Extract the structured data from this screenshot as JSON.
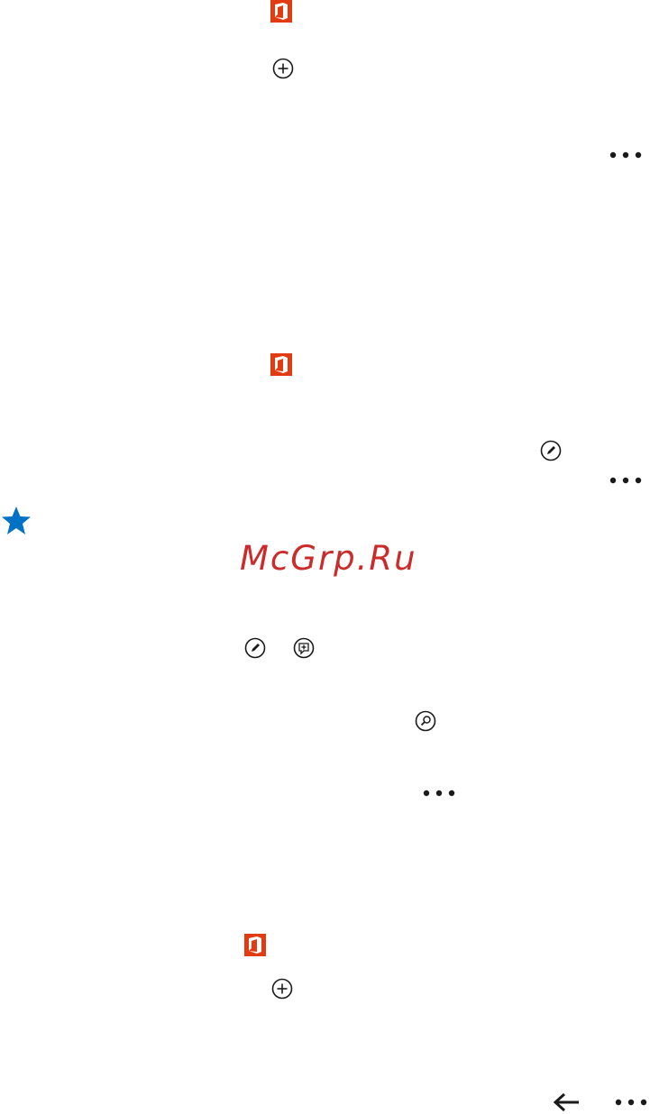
{
  "watermark": {
    "text": "McGrp.Ru",
    "color": "#cc2b2b"
  },
  "icons": {
    "office": "office-logo-icon",
    "add": "add-circle-icon",
    "more": "more-ellipsis-icon",
    "edit": "edit-pencil-circle-icon",
    "add_comment": "add-comment-circle-icon",
    "find": "find-magnifier-circle-icon",
    "back": "back-arrow-icon",
    "favorite": "star-icon"
  },
  "colors": {
    "office_red": "#e23b12",
    "star_blue": "#0072c6",
    "icon_black": "#1a1a1a"
  }
}
